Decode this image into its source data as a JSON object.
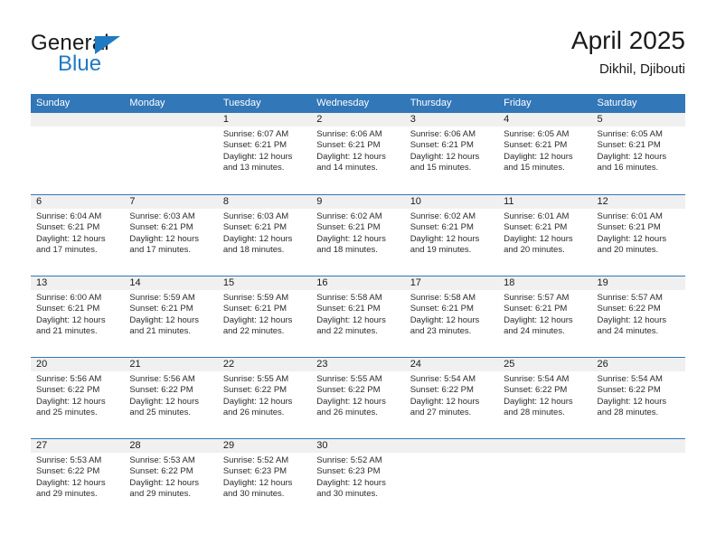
{
  "brand": {
    "name_part1": "General",
    "name_part2": "Blue",
    "accent_color": "#1f7ac4"
  },
  "header": {
    "title": "April 2025",
    "subtitle": "Dikhil, Djibouti"
  },
  "calendar": {
    "header_bg": "#3277b8",
    "day_band_bg": "#f0f0f0",
    "weekday_headers": [
      "Sunday",
      "Monday",
      "Tuesday",
      "Wednesday",
      "Thursday",
      "Friday",
      "Saturday"
    ],
    "weeks": [
      [
        {
          "day": "",
          "sunrise": "",
          "sunset": "",
          "daylight": "",
          "daylight2": ""
        },
        {
          "day": "",
          "sunrise": "",
          "sunset": "",
          "daylight": "",
          "daylight2": ""
        },
        {
          "day": "1",
          "sunrise": "Sunrise: 6:07 AM",
          "sunset": "Sunset: 6:21 PM",
          "daylight": "Daylight: 12 hours",
          "daylight2": "and 13 minutes."
        },
        {
          "day": "2",
          "sunrise": "Sunrise: 6:06 AM",
          "sunset": "Sunset: 6:21 PM",
          "daylight": "Daylight: 12 hours",
          "daylight2": "and 14 minutes."
        },
        {
          "day": "3",
          "sunrise": "Sunrise: 6:06 AM",
          "sunset": "Sunset: 6:21 PM",
          "daylight": "Daylight: 12 hours",
          "daylight2": "and 15 minutes."
        },
        {
          "day": "4",
          "sunrise": "Sunrise: 6:05 AM",
          "sunset": "Sunset: 6:21 PM",
          "daylight": "Daylight: 12 hours",
          "daylight2": "and 15 minutes."
        },
        {
          "day": "5",
          "sunrise": "Sunrise: 6:05 AM",
          "sunset": "Sunset: 6:21 PM",
          "daylight": "Daylight: 12 hours",
          "daylight2": "and 16 minutes."
        }
      ],
      [
        {
          "day": "6",
          "sunrise": "Sunrise: 6:04 AM",
          "sunset": "Sunset: 6:21 PM",
          "daylight": "Daylight: 12 hours",
          "daylight2": "and 17 minutes."
        },
        {
          "day": "7",
          "sunrise": "Sunrise: 6:03 AM",
          "sunset": "Sunset: 6:21 PM",
          "daylight": "Daylight: 12 hours",
          "daylight2": "and 17 minutes."
        },
        {
          "day": "8",
          "sunrise": "Sunrise: 6:03 AM",
          "sunset": "Sunset: 6:21 PM",
          "daylight": "Daylight: 12 hours",
          "daylight2": "and 18 minutes."
        },
        {
          "day": "9",
          "sunrise": "Sunrise: 6:02 AM",
          "sunset": "Sunset: 6:21 PM",
          "daylight": "Daylight: 12 hours",
          "daylight2": "and 18 minutes."
        },
        {
          "day": "10",
          "sunrise": "Sunrise: 6:02 AM",
          "sunset": "Sunset: 6:21 PM",
          "daylight": "Daylight: 12 hours",
          "daylight2": "and 19 minutes."
        },
        {
          "day": "11",
          "sunrise": "Sunrise: 6:01 AM",
          "sunset": "Sunset: 6:21 PM",
          "daylight": "Daylight: 12 hours",
          "daylight2": "and 20 minutes."
        },
        {
          "day": "12",
          "sunrise": "Sunrise: 6:01 AM",
          "sunset": "Sunset: 6:21 PM",
          "daylight": "Daylight: 12 hours",
          "daylight2": "and 20 minutes."
        }
      ],
      [
        {
          "day": "13",
          "sunrise": "Sunrise: 6:00 AM",
          "sunset": "Sunset: 6:21 PM",
          "daylight": "Daylight: 12 hours",
          "daylight2": "and 21 minutes."
        },
        {
          "day": "14",
          "sunrise": "Sunrise: 5:59 AM",
          "sunset": "Sunset: 6:21 PM",
          "daylight": "Daylight: 12 hours",
          "daylight2": "and 21 minutes."
        },
        {
          "day": "15",
          "sunrise": "Sunrise: 5:59 AM",
          "sunset": "Sunset: 6:21 PM",
          "daylight": "Daylight: 12 hours",
          "daylight2": "and 22 minutes."
        },
        {
          "day": "16",
          "sunrise": "Sunrise: 5:58 AM",
          "sunset": "Sunset: 6:21 PM",
          "daylight": "Daylight: 12 hours",
          "daylight2": "and 22 minutes."
        },
        {
          "day": "17",
          "sunrise": "Sunrise: 5:58 AM",
          "sunset": "Sunset: 6:21 PM",
          "daylight": "Daylight: 12 hours",
          "daylight2": "and 23 minutes."
        },
        {
          "day": "18",
          "sunrise": "Sunrise: 5:57 AM",
          "sunset": "Sunset: 6:21 PM",
          "daylight": "Daylight: 12 hours",
          "daylight2": "and 24 minutes."
        },
        {
          "day": "19",
          "sunrise": "Sunrise: 5:57 AM",
          "sunset": "Sunset: 6:22 PM",
          "daylight": "Daylight: 12 hours",
          "daylight2": "and 24 minutes."
        }
      ],
      [
        {
          "day": "20",
          "sunrise": "Sunrise: 5:56 AM",
          "sunset": "Sunset: 6:22 PM",
          "daylight": "Daylight: 12 hours",
          "daylight2": "and 25 minutes."
        },
        {
          "day": "21",
          "sunrise": "Sunrise: 5:56 AM",
          "sunset": "Sunset: 6:22 PM",
          "daylight": "Daylight: 12 hours",
          "daylight2": "and 25 minutes."
        },
        {
          "day": "22",
          "sunrise": "Sunrise: 5:55 AM",
          "sunset": "Sunset: 6:22 PM",
          "daylight": "Daylight: 12 hours",
          "daylight2": "and 26 minutes."
        },
        {
          "day": "23",
          "sunrise": "Sunrise: 5:55 AM",
          "sunset": "Sunset: 6:22 PM",
          "daylight": "Daylight: 12 hours",
          "daylight2": "and 26 minutes."
        },
        {
          "day": "24",
          "sunrise": "Sunrise: 5:54 AM",
          "sunset": "Sunset: 6:22 PM",
          "daylight": "Daylight: 12 hours",
          "daylight2": "and 27 minutes."
        },
        {
          "day": "25",
          "sunrise": "Sunrise: 5:54 AM",
          "sunset": "Sunset: 6:22 PM",
          "daylight": "Daylight: 12 hours",
          "daylight2": "and 28 minutes."
        },
        {
          "day": "26",
          "sunrise": "Sunrise: 5:54 AM",
          "sunset": "Sunset: 6:22 PM",
          "daylight": "Daylight: 12 hours",
          "daylight2": "and 28 minutes."
        }
      ],
      [
        {
          "day": "27",
          "sunrise": "Sunrise: 5:53 AM",
          "sunset": "Sunset: 6:22 PM",
          "daylight": "Daylight: 12 hours",
          "daylight2": "and 29 minutes."
        },
        {
          "day": "28",
          "sunrise": "Sunrise: 5:53 AM",
          "sunset": "Sunset: 6:22 PM",
          "daylight": "Daylight: 12 hours",
          "daylight2": "and 29 minutes."
        },
        {
          "day": "29",
          "sunrise": "Sunrise: 5:52 AM",
          "sunset": "Sunset: 6:23 PM",
          "daylight": "Daylight: 12 hours",
          "daylight2": "and 30 minutes."
        },
        {
          "day": "30",
          "sunrise": "Sunrise: 5:52 AM",
          "sunset": "Sunset: 6:23 PM",
          "daylight": "Daylight: 12 hours",
          "daylight2": "and 30 minutes."
        },
        {
          "day": "",
          "sunrise": "",
          "sunset": "",
          "daylight": "",
          "daylight2": ""
        },
        {
          "day": "",
          "sunrise": "",
          "sunset": "",
          "daylight": "",
          "daylight2": ""
        },
        {
          "day": "",
          "sunrise": "",
          "sunset": "",
          "daylight": "",
          "daylight2": ""
        }
      ]
    ]
  }
}
